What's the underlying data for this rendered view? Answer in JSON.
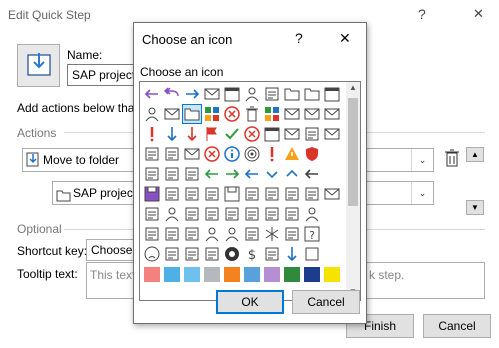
{
  "window": {
    "title": "Edit Quick Step",
    "help": "?",
    "close": "✕"
  },
  "main": {
    "name_label": "Name:",
    "name_value": "SAP project",
    "add_actions_text": "Add actions below that w",
    "actions_header": "Actions",
    "action_select": "Move to folder",
    "folder_select": "SAP project",
    "optional_header": "Optional",
    "shortcut_label": "Shortcut key:",
    "shortcut_value": "Choose a",
    "tooltip_label": "Tooltip text:",
    "tooltip_placeholder_left": "This text w",
    "tooltip_placeholder_right": "k step.",
    "finish_label": "Finish",
    "cancel_label": "Cancel"
  },
  "dialog": {
    "title": "Choose an icon",
    "help": "?",
    "close": "✕",
    "section_label": "Choose an icon",
    "ok_label": "OK",
    "cancel_label": "Cancel"
  },
  "icons": [
    [
      "arrow-back-purple",
      "arrow-reply-all-purple",
      "arrow-forward-blue",
      "envelope-open-icon",
      "calendar-icon",
      "contact-list-icon",
      "task-clipboard-icon",
      "folder-icon",
      "folder-outline-icon",
      "calendar-clock-icon"
    ],
    [
      "person-icon",
      "reply-envelope-icon",
      "move-folder-selected-icon",
      "category-grid-icon",
      "delete-x-icon",
      "trash-icon",
      "colored-squares-icon",
      "envelope-check-icon",
      "envelope-icon",
      "envelope-arrow-icon"
    ],
    [
      "exclamation-red-icon",
      "arrow-down-blue-icon",
      "arrow-down-red-icon",
      "flag-red-icon",
      "checkmark-green-icon",
      "cancel-circle-red-icon",
      "calendar-x-icon",
      "no-mail-icon",
      "inbox-arrow-icon",
      "envelope-x-icon"
    ],
    [
      "printer-icon",
      "org-chart-icon",
      "envelope-people-icon",
      "error-circle-icon",
      "info-circle-icon",
      "target-icon",
      "exclamation-red-icon",
      "warning-triangle-icon",
      "shield-red-icon",
      "blank-icon"
    ],
    [
      "flash-page-icon",
      "home-icon",
      "palette-icon",
      "arrow-left-green-icon",
      "arrow-right-green-icon",
      "arrow-left-blue-icon",
      "chevron-down-blue-icon",
      "chevron-up-blue-icon",
      "arrow-left-circle-icon",
      "blank-icon"
    ],
    [
      "save-disk-purple-icon",
      "document-icon",
      "documents-icon",
      "document-page-icon",
      "save-disk-icon",
      "camera-icon",
      "picture-icon",
      "printer-multi-icon",
      "monitor-blue-icon",
      "envelope-small-icon"
    ],
    [
      "pin-icon",
      "person-star-icon",
      "key-search-icon",
      "bookmark-icon",
      "bookmark-outline-icon",
      "presentation-icon",
      "filter-icon",
      "funnel-icon",
      "person-frame-icon",
      "blank-icon"
    ],
    [
      "balance-scale-icon",
      "bubble-icon",
      "microphone-icon",
      "person-circle-icon",
      "person-dark-icon",
      "gears-icon",
      "snowflake-icon",
      "hand-icon",
      "question-box-icon",
      "blank-icon"
    ],
    [
      "sad-face-icon",
      "calculator-icon",
      "phone-icon",
      "piggy-bank-icon",
      "eight-ball-icon",
      "dollar-icon",
      "eye-icon",
      "arrow-down-small-icon",
      "white-square-icon",
      "blank-icon"
    ]
  ],
  "swatches": [
    "#f4817d",
    "#4fb0e8",
    "#6fc1ed",
    "#b5b9bd",
    "#f58220",
    "#5aa0db",
    "#b48fd3",
    "#2f8a3c",
    "#1b3d8c",
    "#f7e300"
  ],
  "colors": {
    "accent": "#0078d7",
    "button_border": "#adadad"
  }
}
